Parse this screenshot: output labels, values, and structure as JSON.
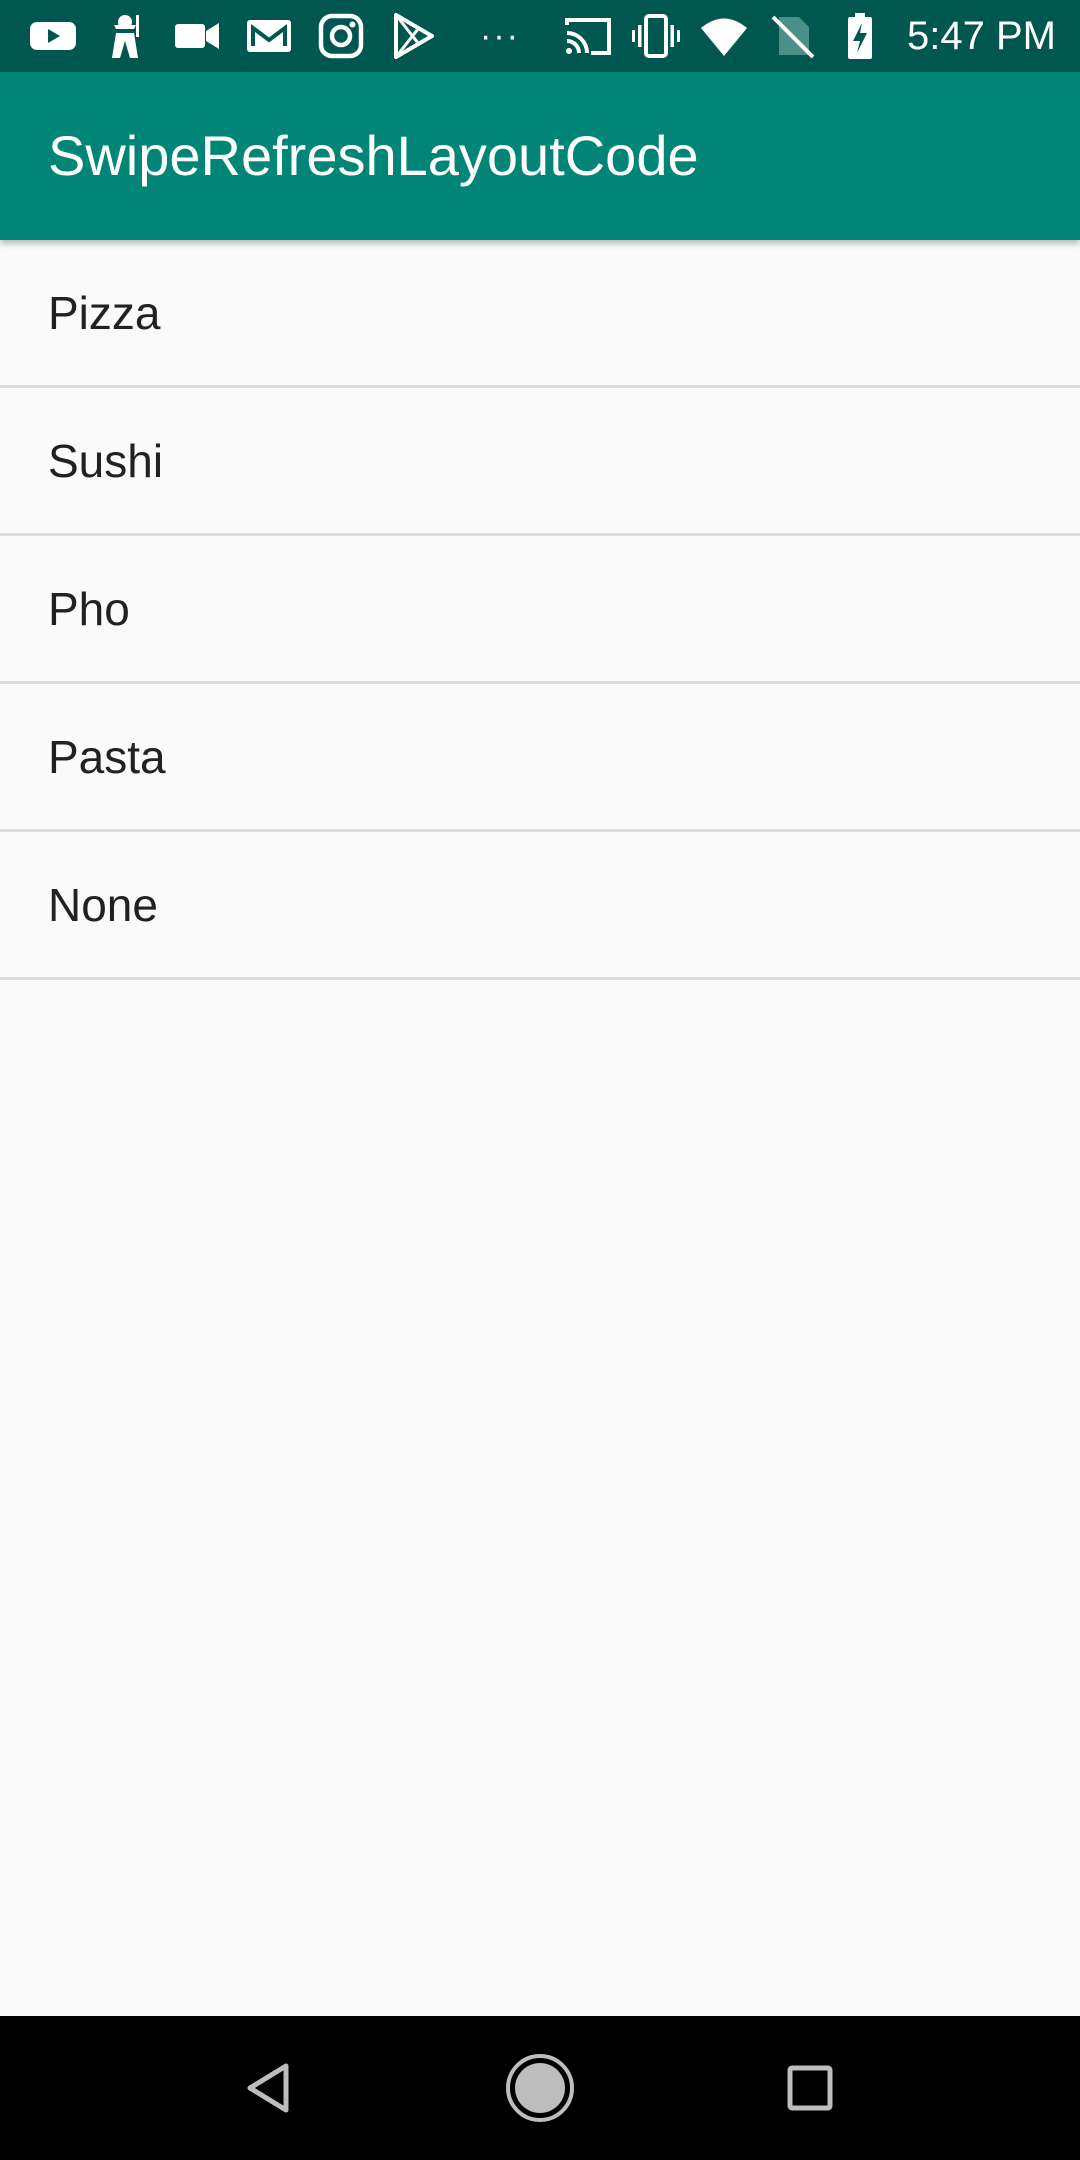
{
  "status_bar": {
    "time": "5:47 PM",
    "dots": "···",
    "left_icons": [
      "youtube-icon",
      "game-character-icon",
      "video-camera-icon",
      "gmail-icon",
      "instagram-icon",
      "play-store-icon"
    ],
    "right_icons": [
      "cast-icon",
      "vibrate-icon",
      "wifi-icon",
      "no-sim-icon",
      "battery-charging-icon"
    ]
  },
  "app_bar": {
    "title": "SwipeRefreshLayoutCode",
    "color": "#008577",
    "status_color": "#00574f"
  },
  "list": {
    "items": [
      {
        "label": "Pizza"
      },
      {
        "label": "Sushi"
      },
      {
        "label": "Pho"
      },
      {
        "label": "Pasta"
      },
      {
        "label": "None"
      }
    ]
  },
  "nav_bar": {
    "buttons": [
      "back-icon",
      "home-icon",
      "recents-icon"
    ]
  }
}
